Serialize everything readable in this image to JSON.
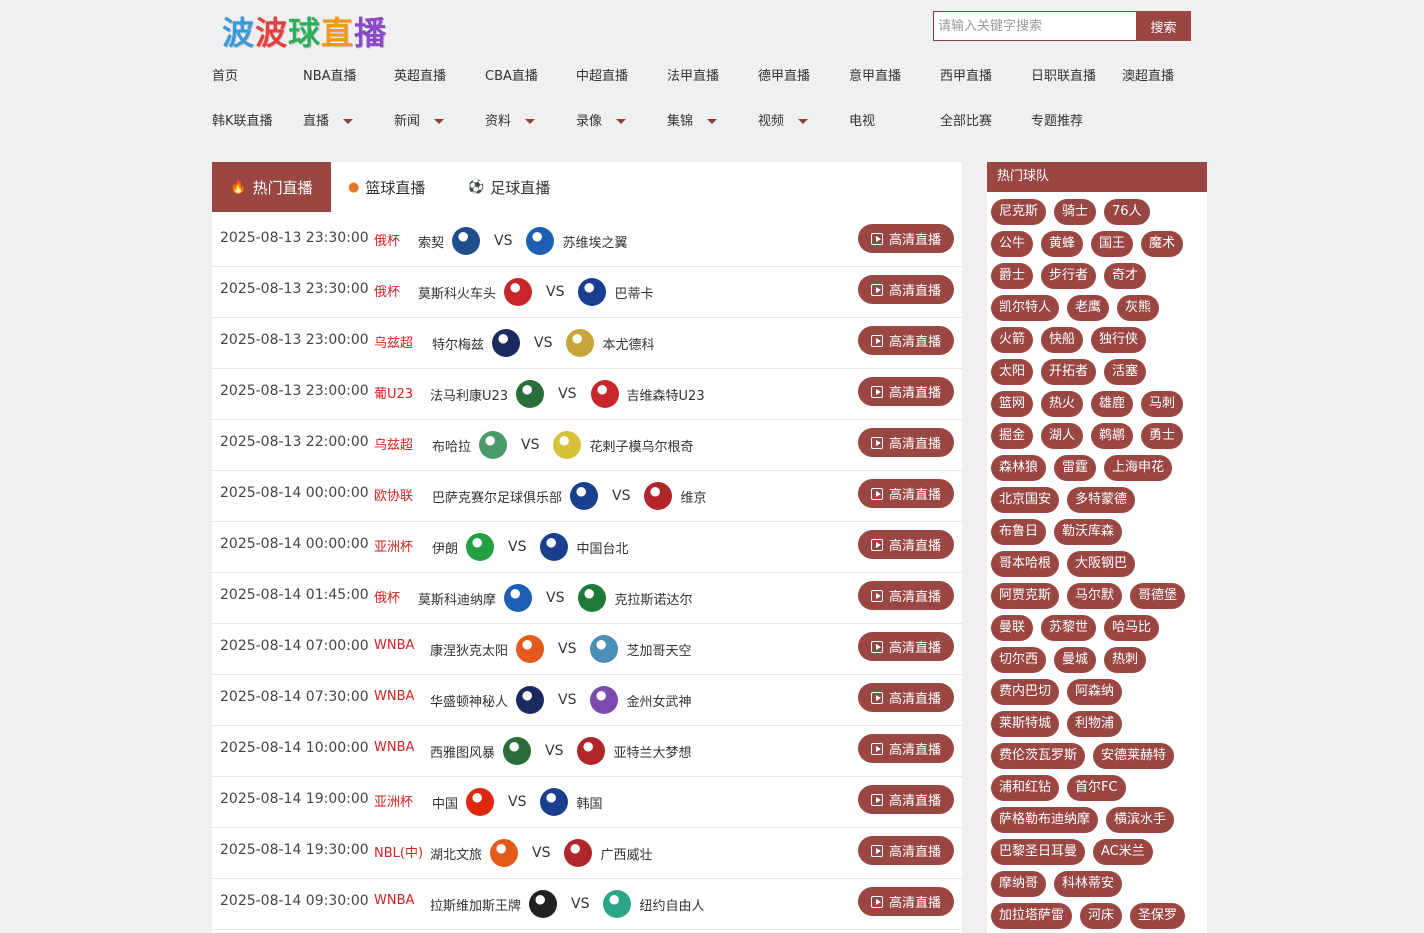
{
  "brand": {
    "logo_text": [
      "波",
      "波",
      "球",
      "直",
      "播"
    ],
    "logo_colors": [
      "#3a9ad9",
      "#e6403a",
      "#2cae5a",
      "#f29a16",
      "#8a49c7"
    ]
  },
  "search": {
    "placeholder": "请输入关键字搜索",
    "button": "搜索"
  },
  "nav_row1": [
    "首页",
    "NBA直播",
    "英超直播",
    "CBA直播",
    "中超直播",
    "法甲直播",
    "德甲直播",
    "意甲直播",
    "西甲直播",
    "日职联直播",
    "澳超直播"
  ],
  "nav_row2": [
    {
      "label": "韩K联直播",
      "dropdown": false
    },
    {
      "label": "直播",
      "dropdown": true
    },
    {
      "label": "新闻",
      "dropdown": true
    },
    {
      "label": "资料",
      "dropdown": true
    },
    {
      "label": "录像",
      "dropdown": true
    },
    {
      "label": "集锦",
      "dropdown": true
    },
    {
      "label": "视频",
      "dropdown": true
    },
    {
      "label": "电视",
      "dropdown": false
    },
    {
      "label": "全部比赛",
      "dropdown": false
    },
    {
      "label": "专题推荐",
      "dropdown": false
    }
  ],
  "tabs": [
    {
      "label": "热门直播",
      "icon": "fire-icon",
      "active": true
    },
    {
      "label": "篮球直播",
      "icon": "basketball-icon",
      "active": false
    },
    {
      "label": "足球直播",
      "icon": "soccer-ball-icon",
      "active": false
    }
  ],
  "live_button": "高清直播",
  "matches": [
    {
      "time": "2025-08-13 23:30:00",
      "league": "俄杯",
      "home": "索契",
      "away": "苏维埃之翼",
      "home_color": "#1f4f8a",
      "away_color": "#1d5fb5"
    },
    {
      "time": "2025-08-13 23:30:00",
      "league": "俄杯",
      "home": "莫斯科火车头",
      "away": "巴蒂卡",
      "home_color": "#c8262b",
      "away_color": "#1b3f8f"
    },
    {
      "time": "2025-08-13 23:00:00",
      "league": "乌兹超",
      "home": "特尔梅兹",
      "away": "本尤德科",
      "home_color": "#1a2a5e",
      "away_color": "#c8a53b"
    },
    {
      "time": "2025-08-13 23:00:00",
      "league": "葡U23",
      "home": "法马利康U23",
      "away": "吉维森特U23",
      "home_color": "#2a6e3a",
      "away_color": "#c8262b"
    },
    {
      "time": "2025-08-13 22:00:00",
      "league": "乌兹超",
      "home": "布哈拉",
      "away": "花剌子模乌尔根奇",
      "home_color": "#4a9a6a",
      "away_color": "#d6c23a"
    },
    {
      "time": "2025-08-14 00:00:00",
      "league": "欧协联",
      "home": "巴萨克赛尔足球俱乐部",
      "away": "维京",
      "home_color": "#1b3f8f",
      "away_color": "#b0262b"
    },
    {
      "time": "2025-08-14 00:00:00",
      "league": "亚洲杯",
      "home": "伊朗",
      "away": "中国台北",
      "home_color": "#239f40",
      "away_color": "#1b3f8f"
    },
    {
      "time": "2025-08-14 01:45:00",
      "league": "俄杯",
      "home": "莫斯科迪纳摩",
      "away": "克拉斯诺达尔",
      "home_color": "#1d5fb5",
      "away_color": "#1e7a3a"
    },
    {
      "time": "2025-08-14 07:00:00",
      "league": "WNBA",
      "home": "康涅狄克太阳",
      "away": "芝加哥天空",
      "home_color": "#e35a1b",
      "away_color": "#4a8fb5"
    },
    {
      "time": "2025-08-14 07:30:00",
      "league": "WNBA",
      "home": "华盛顿神秘人",
      "away": "金州女武神",
      "home_color": "#1a2a5e",
      "away_color": "#7a4ab0"
    },
    {
      "time": "2025-08-14 10:00:00",
      "league": "WNBA",
      "home": "西雅图风暴",
      "away": "亚特兰大梦想",
      "home_color": "#2c6b3a",
      "away_color": "#b0262b"
    },
    {
      "time": "2025-08-14 19:00:00",
      "league": "亚洲杯",
      "home": "中国",
      "away": "韩国",
      "home_color": "#de2910",
      "away_color": "#1b3f8f"
    },
    {
      "time": "2025-08-14 19:30:00",
      "league": "NBL(中)",
      "home": "湖北文旅",
      "away": "广西威壮",
      "home_color": "#e35a1b",
      "away_color": "#b0262b"
    },
    {
      "time": "2025-08-14 09:30:00",
      "league": "WNBA",
      "home": "拉斯维加斯王牌",
      "away": "纽约自由人",
      "home_color": "#222222",
      "away_color": "#2aa58a"
    }
  ],
  "sidebar": {
    "title": "热门球队",
    "rows": [
      [
        "尼克斯",
        "骑士",
        "76人"
      ],
      [
        "公牛",
        "黄蜂",
        "国王",
        "魔术"
      ],
      [
        "爵士",
        "步行者",
        "奇才"
      ],
      [
        "凯尔特人",
        "老鹰",
        "灰熊"
      ],
      [
        "火箭",
        "快船",
        "独行侠"
      ],
      [
        "太阳",
        "开拓者",
        "活塞"
      ],
      [
        "篮网",
        "热火",
        "雄鹿",
        "马刺"
      ],
      [
        "掘金",
        "湖人",
        "鹈鹕",
        "勇士"
      ],
      [
        "森林狼",
        "雷霆",
        "上海申花"
      ],
      [
        "北京国安",
        "多特蒙德"
      ],
      [
        "布鲁日",
        "勒沃库森"
      ],
      [
        "哥本哈根",
        "大阪钢巴"
      ],
      [
        "阿贾克斯",
        "马尔默",
        "哥德堡"
      ],
      [
        "曼联",
        "苏黎世",
        "哈马比"
      ],
      [
        "切尔西",
        "曼城",
        "热刺"
      ],
      [
        "费内巴切",
        "阿森纳"
      ],
      [
        "莱斯特城",
        "利物浦"
      ],
      [
        "费伦茨瓦罗斯",
        "安德莱赫特"
      ],
      [
        "浦和红钻",
        "首尔FC"
      ],
      [
        "萨格勒布迪纳摩",
        "横滨水手"
      ],
      [
        "巴黎圣日耳曼",
        "AC米兰"
      ],
      [
        "摩纳哥",
        "科林蒂安"
      ],
      [
        "加拉塔萨雷",
        "河床",
        "圣保罗"
      ]
    ]
  },
  "colors": {
    "accent": "#9a4643",
    "league_red": "#d02323"
  }
}
